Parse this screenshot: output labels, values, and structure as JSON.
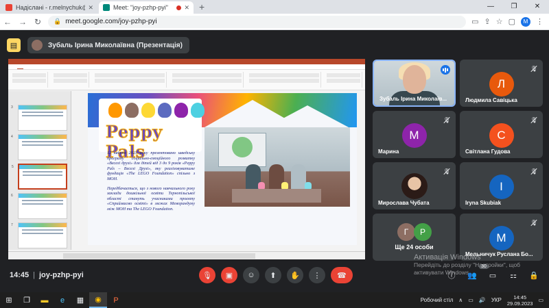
{
  "browser": {
    "tabs": [
      {
        "title": "Надіслані - r.melnychuk@ippo.k",
        "active": false
      },
      {
        "title": "Meet: \"joy-pzhp-pyi\"",
        "active": true
      }
    ],
    "url": "meet.google.com/joy-pzhp-pyi",
    "profile_initial": "M",
    "window_controls": [
      "—",
      "❐",
      "✕"
    ]
  },
  "meet": {
    "presenter_label": "Зубаль Ірина Миколаївна (Презентація)",
    "time": "14:45",
    "meeting_code": "joy-pzhp-pyi",
    "participants_count": "30",
    "colors": {
      "accent": "#8ab4f8",
      "end_call": "#ea4335",
      "present_badge": "#fdd663"
    }
  },
  "slide": {
    "logo": "Peppy Pals",
    "paragraph1": "12 квітня 2023 року презентовано шведську програму соціально-емоційного розвитку «Веселі друзі» для дітей від 3 до 9 років «Peppy Pals – Веселі Друзі», яку реалізовуватиме фундація «The LEGO Foundation» спільно з МОН.",
    "paragraph2": "Передбачається, що з нового навчального року заклади дошкільної освіти Тернопільської області стануть учасниками проєкту «Сприймаємо освіті» в межах Меморандуму між МОН та The LEGO Foundation."
  },
  "participants": [
    {
      "name": "Зубаль Ірина Миколаїв...",
      "type": "video",
      "speaking": true
    },
    {
      "name": "Людмила Савіцька",
      "initial": "Л",
      "color": "#e8590c"
    },
    {
      "name": "Марина",
      "initial": "M",
      "color": "#8e24aa"
    },
    {
      "name": "Світлана Гудова",
      "initial": "С",
      "color": "#f4511e"
    },
    {
      "name": "Мирослава Чубата",
      "type": "photo"
    },
    {
      "name": "Iryna Skubiak",
      "initial": "I",
      "color": "#1565c0"
    },
    {
      "name": "Ще 24 особи",
      "type": "group",
      "initials": [
        "Г",
        "Р"
      ],
      "colors": [
        "#8d6e63",
        "#43a047"
      ]
    },
    {
      "name": "Мельничук Руслана Бо...",
      "initial": "M",
      "color": "#1565c0"
    }
  ],
  "watermark": {
    "title": "Активація Windows",
    "line1": "Перейдіть до розділу \"Настройки\", щоб",
    "line2": "активувати Windows."
  },
  "taskbar": {
    "desktop_label": "Робочий стіл",
    "language": "УКР",
    "time": "14:45",
    "date": "29.09.2023"
  }
}
